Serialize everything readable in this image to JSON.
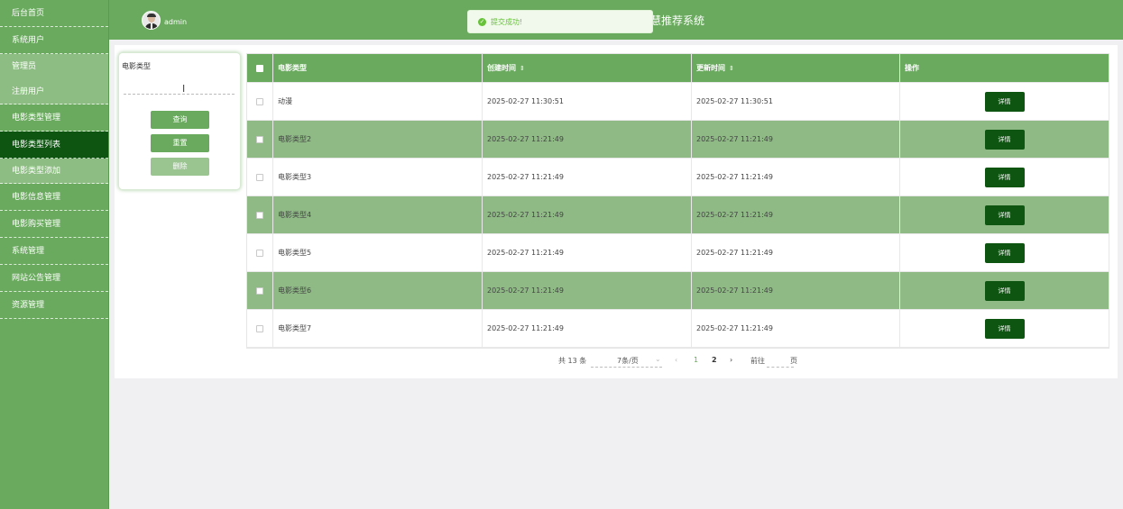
{
  "sidebar": {
    "items": [
      {
        "label": "后台首页"
      },
      {
        "label": "系统用户"
      },
      {
        "label": "管理员"
      },
      {
        "label": "注册用户"
      },
      {
        "label": "电影类型管理"
      },
      {
        "label": "电影类型列表"
      },
      {
        "label": "电影类型添加"
      },
      {
        "label": "电影信息管理"
      },
      {
        "label": "电影购买管理"
      },
      {
        "label": "系统管理"
      },
      {
        "label": "网站公告管理"
      },
      {
        "label": "资源管理"
      }
    ]
  },
  "header": {
    "username": "admin",
    "system_title": "慧推荐系统"
  },
  "toast": {
    "message": "提交成功!",
    "icon": "check-circle-icon"
  },
  "search": {
    "label": "电影类型",
    "value": "",
    "query_button": "查询",
    "reset_button": "重置",
    "delete_button": "删除"
  },
  "table": {
    "columns": [
      "电影类型",
      "创建时间",
      "更新时间",
      "操作"
    ],
    "rows": [
      {
        "type": "动漫",
        "created": "2025-02-27 11:30:51",
        "updated": "2025-02-27 11:30:51",
        "action": "详情"
      },
      {
        "type": "电影类型2",
        "created": "2025-02-27 11:21:49",
        "updated": "2025-02-27 11:21:49",
        "action": "详情"
      },
      {
        "type": "电影类型3",
        "created": "2025-02-27 11:21:49",
        "updated": "2025-02-27 11:21:49",
        "action": "详情"
      },
      {
        "type": "电影类型4",
        "created": "2025-02-27 11:21:49",
        "updated": "2025-02-27 11:21:49",
        "action": "详情"
      },
      {
        "type": "电影类型5",
        "created": "2025-02-27 11:21:49",
        "updated": "2025-02-27 11:21:49",
        "action": "详情"
      },
      {
        "type": "电影类型6",
        "created": "2025-02-27 11:21:49",
        "updated": "2025-02-27 11:21:49",
        "action": "详情"
      },
      {
        "type": "电影类型7",
        "created": "2025-02-27 11:21:49",
        "updated": "2025-02-27 11:21:49",
        "action": "详情"
      }
    ]
  },
  "pagination": {
    "total": "共 13 条",
    "page_size": "7条/页",
    "pages": [
      "1",
      "2"
    ],
    "current_page": "1",
    "goto_label": "前往",
    "page_label": "页"
  },
  "colors": {
    "primary": "#6aaa5e",
    "active": "#0e5511",
    "row_alt": "#8fba86"
  }
}
